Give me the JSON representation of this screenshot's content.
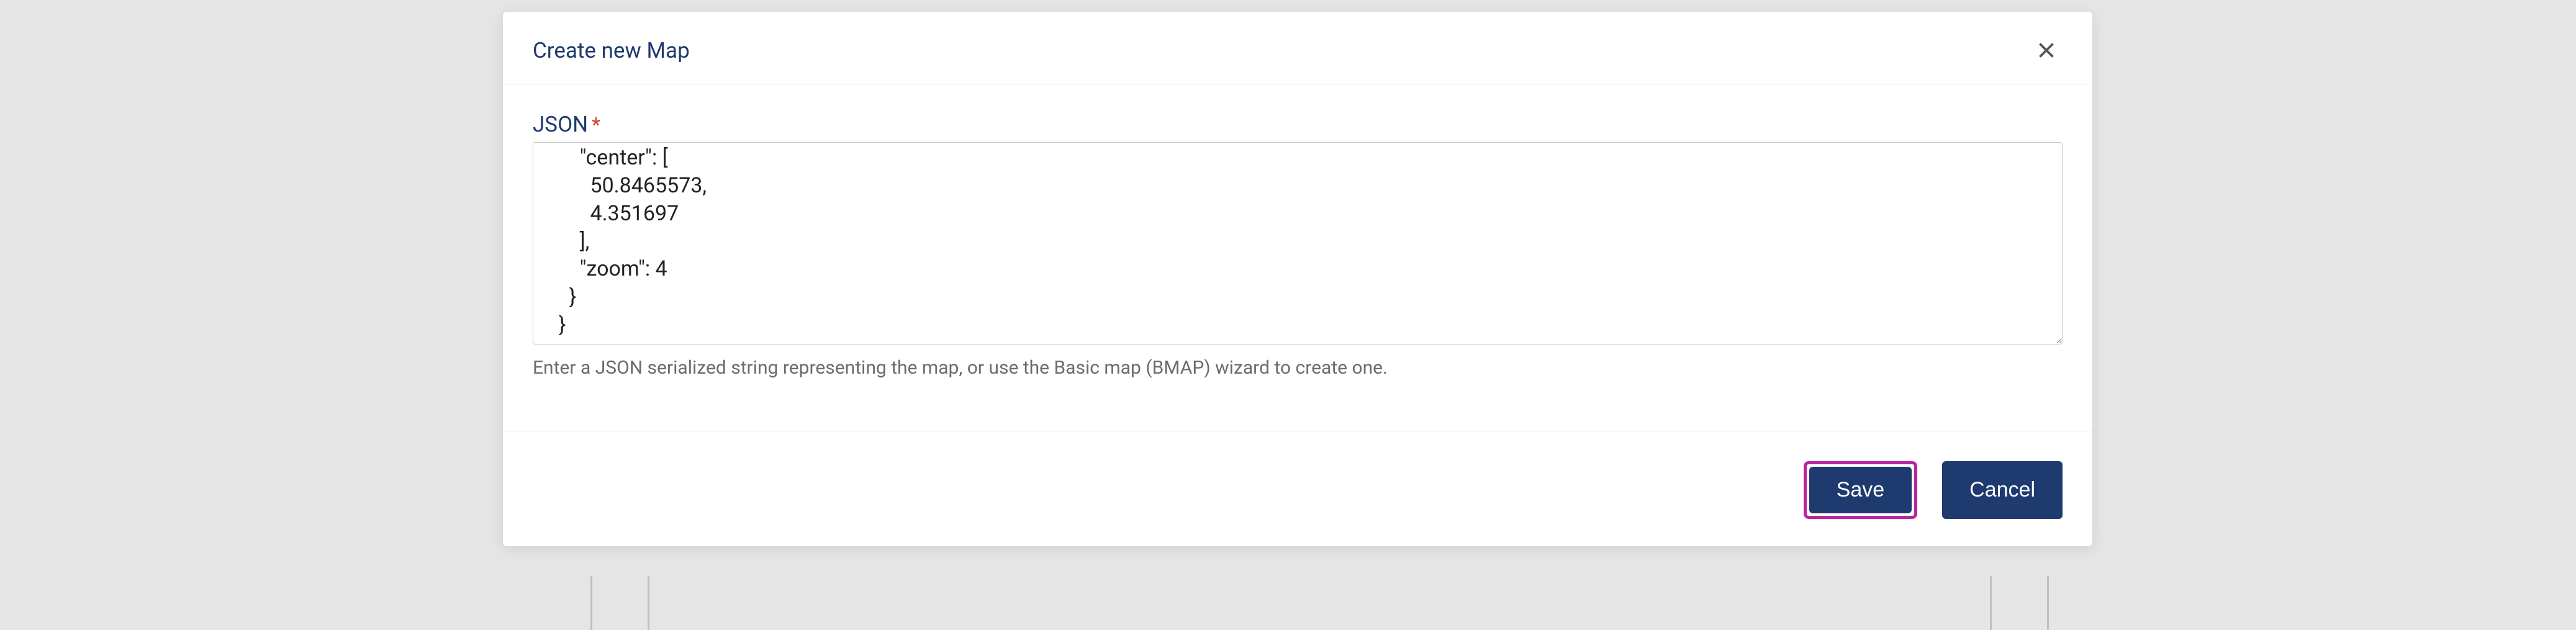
{
  "modal": {
    "title": "Create new Map",
    "field_label": "JSON",
    "required_marker": "*",
    "json_value": "      ],\n      \"center\": [\n        50.8465573,\n        4.351697\n      ],\n      \"zoom\": 4\n    }\n  }",
    "help_text": "Enter a JSON serialized string representing the map, or use the Basic map (BMAP) wizard to create one.",
    "save_label": "Save",
    "cancel_label": "Cancel"
  }
}
